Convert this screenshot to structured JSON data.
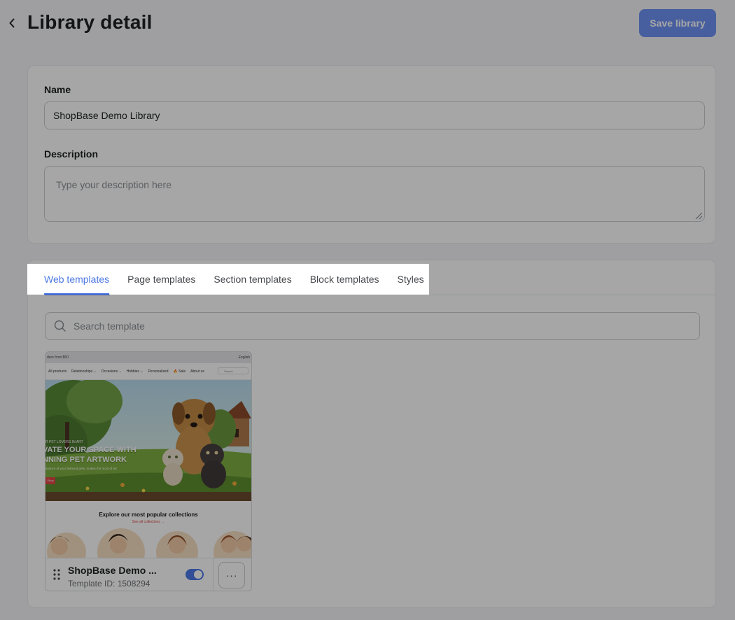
{
  "header": {
    "title": "Library detail",
    "save_label": "Save library"
  },
  "form": {
    "name_label": "Name",
    "name_value": "ShopBase Demo Library",
    "description_label": "Description",
    "description_placeholder": "Type your description here"
  },
  "tabs": [
    {
      "label": "Web templates",
      "active": true
    },
    {
      "label": "Page templates",
      "active": false
    },
    {
      "label": "Section templates",
      "active": false
    },
    {
      "label": "Block templates",
      "active": false
    },
    {
      "label": "Styles",
      "active": false
    }
  ],
  "search": {
    "placeholder": "Search template"
  },
  "template_card": {
    "name": "ShopBase Demo ...",
    "id_text": "Template ID: 1508294",
    "enabled": true,
    "more_label": "···",
    "thumbnail": {
      "topbar_left": "ders from $50",
      "topbar_right": "English",
      "nav_items": [
        "All products",
        "Relationships ⌄",
        "Occasions ⌄",
        "Hobbies ⌄",
        "Personalized",
        "🔥 Sale",
        "About us"
      ],
      "search_label": "Search",
      "hero_pre": "R PET LOVERS IN ART",
      "hero_title_line1": "VATE YOUR SPACE WITH",
      "hero_title_line2": "NNING PET ARTWORK",
      "hero_sub": "ssence of your beloved pets, makes the most of art",
      "hero_button": "Shop",
      "explore_title": "Explore our most popular collections",
      "explore_link": "See all collections →"
    }
  },
  "colors": {
    "accent": "#4c78e6",
    "save_button": "#6f93f5",
    "overlay": "rgba(0,0,0,0.35)"
  }
}
